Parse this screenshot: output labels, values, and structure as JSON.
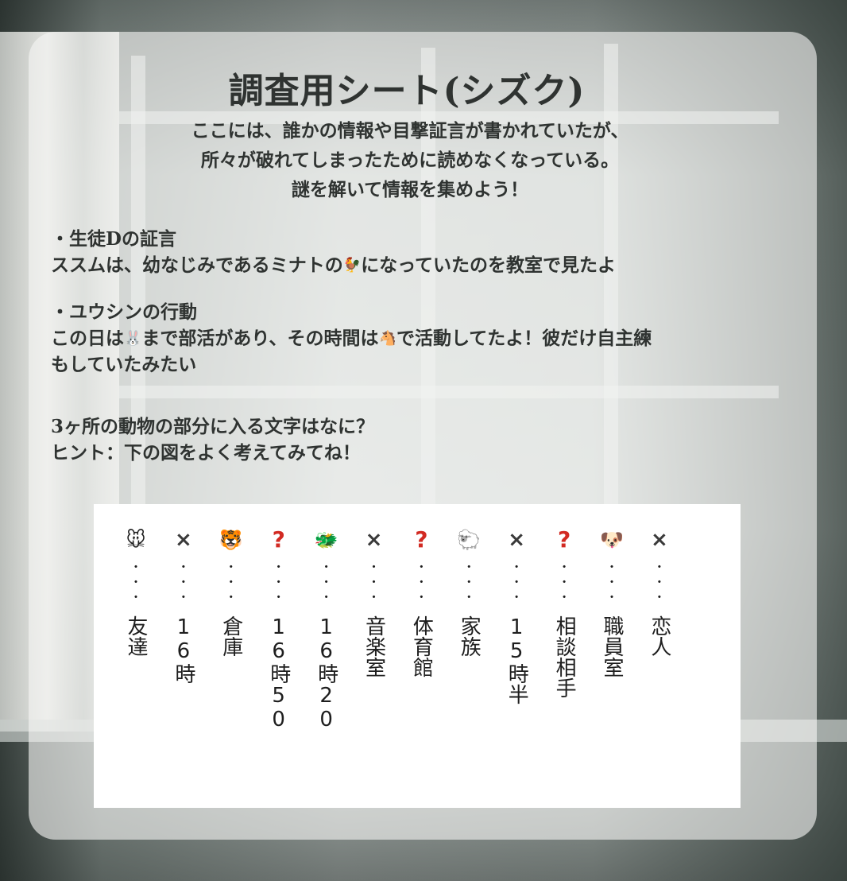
{
  "title": "調査用シート(シズク)",
  "intro": [
    "ここには、誰かの情報や目撃証言が書かれていたが、",
    "所々が破れてしまったために読めなくなっている。",
    "謎を解いて情報を集めよう！"
  ],
  "testimony_d": {
    "heading": "・生徒Dの証言",
    "before": "ススムは、幼なじみであるミナトの",
    "emoji": "🐓",
    "after": "になっていたのを教室で見たよ"
  },
  "yuushin": {
    "heading": "・ユウシンの行動",
    "l1_a": "この日は",
    "l1_emoji1": "🐰",
    "l1_b": "まで部活があり、その時間は",
    "l1_emoji2": "🐴",
    "l1_c": "で活動してたよ！彼だけ自主練",
    "l2": "もしていたみたい"
  },
  "question": {
    "line1": "3ヶ所の動物の部分に入る文字はなに？",
    "line2": "ヒント：下の図をよく考えてみてね！"
  },
  "hint_table": [
    {
      "icon": "🐭",
      "icon_name": "rat-icon",
      "type": "emoji",
      "text": "友達"
    },
    {
      "icon": "×",
      "icon_name": "cross-icon",
      "type": "x",
      "text": "16時"
    },
    {
      "icon": "🐯",
      "icon_name": "tiger-icon",
      "type": "emoji",
      "text": "倉庫"
    },
    {
      "icon": "?",
      "icon_name": "question-icon",
      "type": "q",
      "text": "16時50"
    },
    {
      "icon": "🐲",
      "icon_name": "dragon-icon",
      "type": "emoji",
      "text": "16時20"
    },
    {
      "icon": "×",
      "icon_name": "cross-icon",
      "type": "x",
      "text": "音楽室"
    },
    {
      "icon": "?",
      "icon_name": "question-icon",
      "type": "q",
      "text": "体育館"
    },
    {
      "icon": "🐑",
      "icon_name": "sheep-icon",
      "type": "emoji",
      "text": "家族"
    },
    {
      "icon": "×",
      "icon_name": "cross-icon",
      "type": "x",
      "text": "15時半"
    },
    {
      "icon": "?",
      "icon_name": "question-icon",
      "type": "q",
      "text": "相談相手"
    },
    {
      "icon": "🐶",
      "icon_name": "dog-icon",
      "type": "emoji",
      "text": "職員室"
    },
    {
      "icon": "×",
      "icon_name": "cross-icon",
      "type": "x",
      "text": "恋人"
    }
  ]
}
